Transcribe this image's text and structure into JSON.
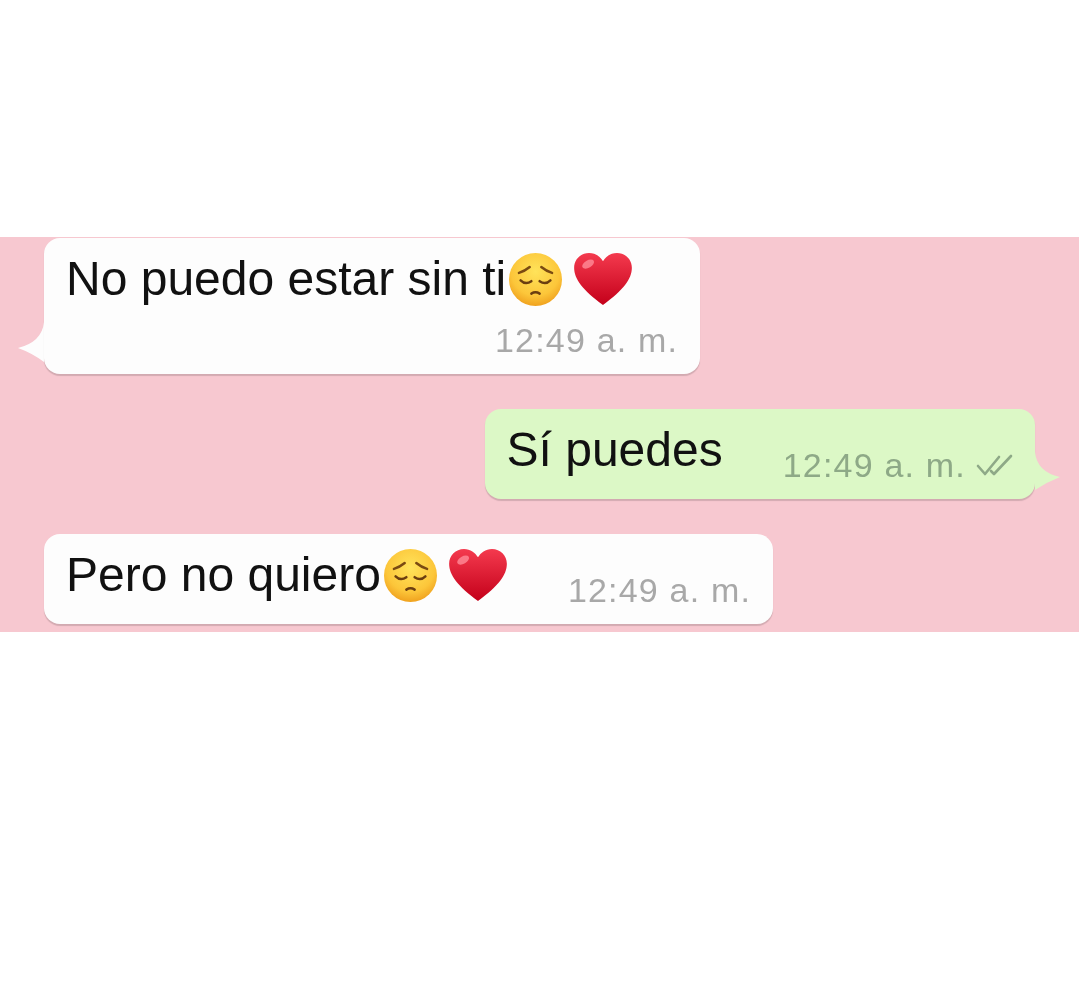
{
  "chat": {
    "messages": [
      {
        "kind": "incoming",
        "tail": true,
        "text": "No puedo estar sin ti",
        "emojis": [
          {
            "kind": "sad-face"
          },
          {
            "kind": "heart"
          }
        ],
        "time": "12:49 a. m."
      },
      {
        "kind": "outgoing",
        "tail": true,
        "text": "Sí puedes",
        "time": "12:49 a. m.",
        "delivered": true
      },
      {
        "kind": "incoming",
        "tail": false,
        "text": "Pero no quiero",
        "emojis": [
          {
            "kind": "sad-face"
          },
          {
            "kind": "heart"
          }
        ],
        "time": "12:49 a. m."
      }
    ]
  }
}
